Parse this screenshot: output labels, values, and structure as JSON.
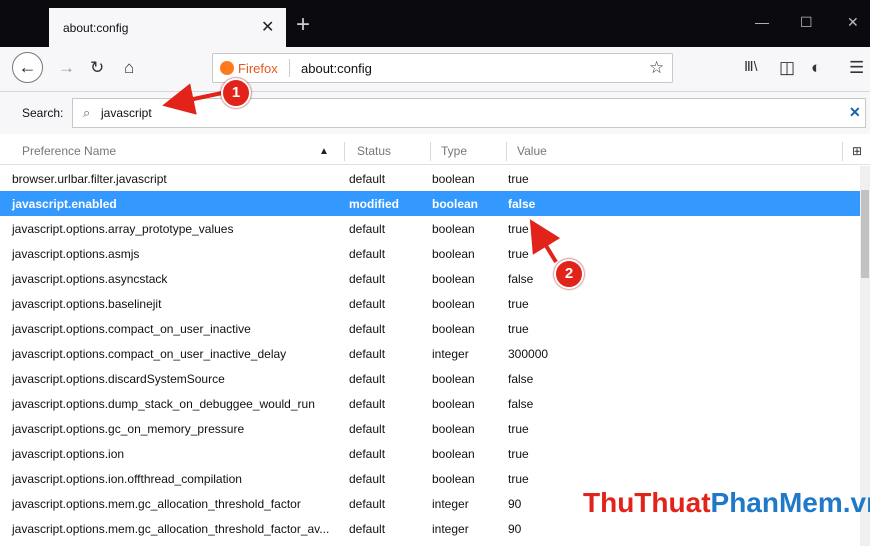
{
  "tab": {
    "title": "about:config",
    "close": "✕",
    "new_tab": "+"
  },
  "window": {
    "minimize": "—",
    "maximize": "☐",
    "close": "✕"
  },
  "nav": {
    "back": "←",
    "forward": "→",
    "reload": "↻",
    "home": "⌂",
    "library": "Ⅲ\\",
    "sidebar": "◫",
    "account": "◐",
    "menu": "☰"
  },
  "urlbar": {
    "brand": "Firefox",
    "url": "about:config",
    "star": "☆"
  },
  "search": {
    "label": "Search:",
    "icon": "⌕",
    "value": "javascript",
    "clear": "✕"
  },
  "columns": {
    "name": "Preference Name",
    "sort": "▲",
    "status": "Status",
    "type": "Type",
    "value": "Value",
    "picker": "⊞"
  },
  "rows": [
    {
      "name": "browser.urlbar.filter.javascript",
      "status": "default",
      "type": "boolean",
      "value": "true"
    },
    {
      "name": "javascript.enabled",
      "status": "modified",
      "type": "boolean",
      "value": "false"
    },
    {
      "name": "javascript.options.array_prototype_values",
      "status": "default",
      "type": "boolean",
      "value": "true"
    },
    {
      "name": "javascript.options.asmjs",
      "status": "default",
      "type": "boolean",
      "value": "true"
    },
    {
      "name": "javascript.options.asyncstack",
      "status": "default",
      "type": "boolean",
      "value": "false"
    },
    {
      "name": "javascript.options.baselinejit",
      "status": "default",
      "type": "boolean",
      "value": "true"
    },
    {
      "name": "javascript.options.compact_on_user_inactive",
      "status": "default",
      "type": "boolean",
      "value": "true"
    },
    {
      "name": "javascript.options.compact_on_user_inactive_delay",
      "status": "default",
      "type": "integer",
      "value": "300000"
    },
    {
      "name": "javascript.options.discardSystemSource",
      "status": "default",
      "type": "boolean",
      "value": "false"
    },
    {
      "name": "javascript.options.dump_stack_on_debuggee_would_run",
      "status": "default",
      "type": "boolean",
      "value": "false"
    },
    {
      "name": "javascript.options.gc_on_memory_pressure",
      "status": "default",
      "type": "boolean",
      "value": "true"
    },
    {
      "name": "javascript.options.ion",
      "status": "default",
      "type": "boolean",
      "value": "true"
    },
    {
      "name": "javascript.options.ion.offthread_compilation",
      "status": "default",
      "type": "boolean",
      "value": "true"
    },
    {
      "name": "javascript.options.mem.gc_allocation_threshold_factor",
      "status": "default",
      "type": "integer",
      "value": "90"
    },
    {
      "name": "javascript.options.mem.gc_allocation_threshold_factor_av...",
      "status": "default",
      "type": "integer",
      "value": "90"
    }
  ],
  "annotations": {
    "callout_1": "1",
    "callout_2": "2"
  },
  "watermark": {
    "part1": "ThuThuat",
    "part2": "PhanMem",
    "part3": ".vn"
  },
  "colors": {
    "selection": "#3399ff",
    "callout": "#e2231a",
    "firefox": "#e8571c",
    "wm_red": "#e2231a",
    "wm_blue": "#1f78c8"
  }
}
